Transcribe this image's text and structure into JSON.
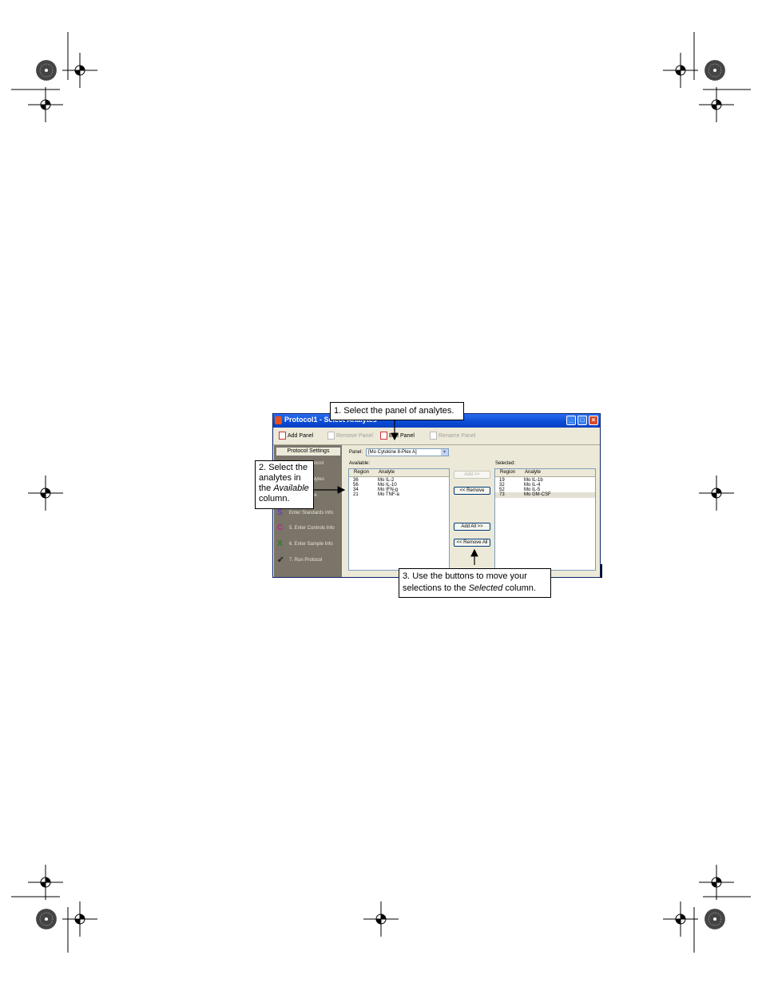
{
  "window": {
    "title": "Protocol1 - Select Analytes",
    "minimize_glyph": "_",
    "maximize_glyph": "□",
    "close_glyph": "×"
  },
  "toolbar": {
    "add_panel": "Add Panel",
    "remove_panel": "Remove Panel",
    "edit_panel": "Edit Panel",
    "rename_panel": "Rename Panel"
  },
  "sidebar": {
    "header": "Protocol Settings",
    "items": [
      {
        "label": "Protocol",
        "icon": "protocol-icon"
      },
      {
        "label": "Analytes",
        "icon": "analytes-icon"
      },
      {
        "label": "Plate",
        "icon": "plate-icon"
      },
      {
        "label": "Enter Standards Info",
        "icon": "standards-icon",
        "glyph": "S"
      },
      {
        "label": "5. Enter Controls Info",
        "icon": "controls-icon",
        "glyph": "C"
      },
      {
        "label": "6. Enter Sample Info",
        "icon": "sample-icon",
        "glyph": "X"
      },
      {
        "label": "7. Run Protocol",
        "icon": "run-icon",
        "glyph": "➶"
      }
    ]
  },
  "main": {
    "panel_label": "Panel:",
    "panel_value": "[Mo Cytokine 8-Plex A]",
    "available_label": "Available:",
    "selected_label": "Selected:",
    "col_region": "Region",
    "col_analyte": "Analyte",
    "available": [
      {
        "region": "36",
        "analyte": "Mo IL-2"
      },
      {
        "region": "56",
        "analyte": "Mo IL-10"
      },
      {
        "region": "34",
        "analyte": "Mo IFN-g"
      },
      {
        "region": "21",
        "analyte": "Mo TNF-a"
      }
    ],
    "selected": [
      {
        "region": "19",
        "analyte": "Mo IL-1b"
      },
      {
        "region": "32",
        "analyte": "Mo IL-4"
      },
      {
        "region": "52",
        "analyte": "Mo IL-5"
      },
      {
        "region": "73",
        "analyte": "Mo GM-CSF"
      }
    ],
    "buttons": {
      "add": "Add >>",
      "remove": "<< Remove",
      "add_all": "Add All >>",
      "remove_all": "<< Remove All"
    }
  },
  "callouts": {
    "c1": "1. Select the panel of analytes.",
    "c2_pre": "2. Select the analytes in the ",
    "c2_em": "Available",
    "c2_post": " column.",
    "c3_pre": "3. Use the buttons to move your selections to the ",
    "c3_em": "Selected",
    "c3_post": " column."
  }
}
